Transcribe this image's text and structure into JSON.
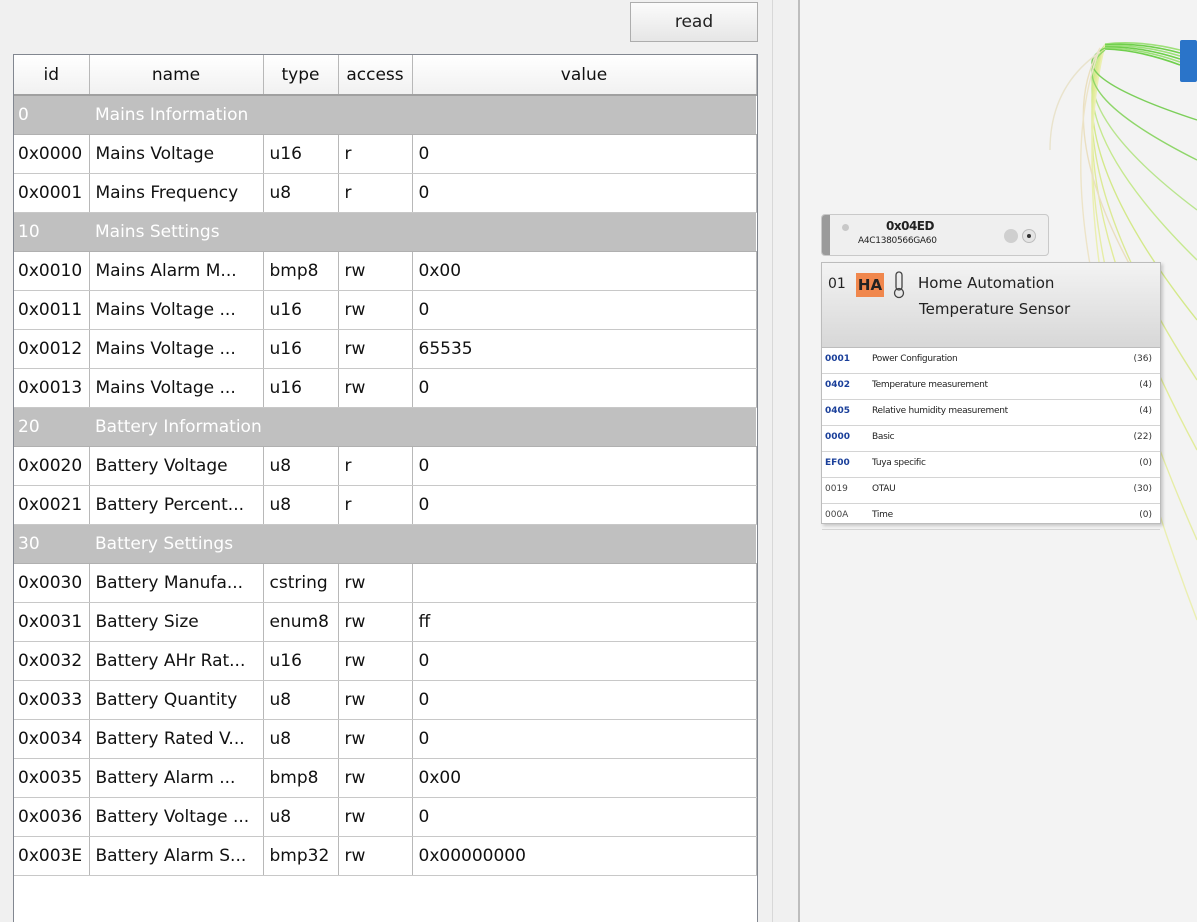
{
  "toolbar": {
    "read_label": "read"
  },
  "table": {
    "columns": [
      "id",
      "name",
      "type",
      "access",
      "value"
    ],
    "rows": [
      {
        "kind": "group",
        "id": "0",
        "name": "Mains Information"
      },
      {
        "kind": "attr",
        "id": "0x0000",
        "name": "Mains Voltage",
        "type": "u16",
        "access": "r",
        "value": "0"
      },
      {
        "kind": "attr",
        "id": "0x0001",
        "name": "Mains Frequency",
        "type": "u8",
        "access": "r",
        "value": "0"
      },
      {
        "kind": "group",
        "id": "10",
        "name": "Mains Settings"
      },
      {
        "kind": "attr",
        "id": "0x0010",
        "name": "Mains Alarm M...",
        "type": "bmp8",
        "access": "rw",
        "value": "0x00"
      },
      {
        "kind": "attr",
        "id": "0x0011",
        "name": "Mains Voltage ...",
        "type": "u16",
        "access": "rw",
        "value": "0"
      },
      {
        "kind": "attr",
        "id": "0x0012",
        "name": "Mains Voltage ...",
        "type": "u16",
        "access": "rw",
        "value": "65535"
      },
      {
        "kind": "attr",
        "id": "0x0013",
        "name": "Mains Voltage ...",
        "type": "u16",
        "access": "rw",
        "value": "0"
      },
      {
        "kind": "group",
        "id": "20",
        "name": "Battery Information"
      },
      {
        "kind": "attr",
        "id": "0x0020",
        "name": "Battery Voltage",
        "type": "u8",
        "access": "r",
        "value": "0"
      },
      {
        "kind": "attr",
        "id": "0x0021",
        "name": "Battery Percent...",
        "type": "u8",
        "access": "r",
        "value": "0"
      },
      {
        "kind": "group",
        "id": "30",
        "name": "Battery Settings"
      },
      {
        "kind": "attr",
        "id": "0x0030",
        "name": "Battery Manufa...",
        "type": "cstring",
        "access": "rw",
        "value": ""
      },
      {
        "kind": "attr",
        "id": "0x0031",
        "name": "Battery Size",
        "type": "enum8",
        "access": "rw",
        "value": "ff"
      },
      {
        "kind": "attr",
        "id": "0x0032",
        "name": "Battery AHr Rat...",
        "type": "u16",
        "access": "rw",
        "value": "0"
      },
      {
        "kind": "attr",
        "id": "0x0033",
        "name": "Battery Quantity",
        "type": "u8",
        "access": "rw",
        "value": "0"
      },
      {
        "kind": "attr",
        "id": "0x0034",
        "name": "Battery Rated V...",
        "type": "u8",
        "access": "rw",
        "value": "0"
      },
      {
        "kind": "attr",
        "id": "0x0035",
        "name": "Battery Alarm ...",
        "type": "bmp8",
        "access": "rw",
        "value": "0x00"
      },
      {
        "kind": "attr",
        "id": "0x0036",
        "name": "Battery Voltage ...",
        "type": "u8",
        "access": "rw",
        "value": "0"
      },
      {
        "kind": "attr",
        "id": "0x003E",
        "name": "Battery Alarm S...",
        "type": "bmp32",
        "access": "rw",
        "value": "0x00000000"
      }
    ]
  },
  "node": {
    "nwk_address": "0x04ED",
    "mac_address": "A4C1380566GA60",
    "endpoint": {
      "number": "01",
      "profile_badge": "HA",
      "device_line1": "Home Automation",
      "device_line2": "Temperature Sensor",
      "clusters": [
        {
          "id": "0001",
          "name": "Power Configuration",
          "count": "(36)",
          "highlight": true
        },
        {
          "id": "0402",
          "name": "Temperature measurement",
          "count": "(4)",
          "highlight": true
        },
        {
          "id": "0405",
          "name": "Relative humidity measurement",
          "count": "(4)",
          "highlight": true
        },
        {
          "id": "0000",
          "name": "Basic",
          "count": "(22)",
          "highlight": true
        },
        {
          "id": "EF00",
          "name": "Tuya specific",
          "count": "(0)",
          "highlight": true
        },
        {
          "id": "0019",
          "name": "OTAU",
          "count": "(30)",
          "highlight": false
        },
        {
          "id": "000A",
          "name": "Time",
          "count": "(0)",
          "highlight": false
        }
      ]
    }
  },
  "colors": {
    "group_row_bg": "#c0c0c0",
    "ha_badge": "#f0874d",
    "cluster_id_blue": "#1a3f9a",
    "link_green": "#7ccf5a",
    "link_yellow": "#d8e27a",
    "coordinator_blue": "#2a74c9"
  },
  "icons": {
    "endpoint_device": "thermometer-icon"
  }
}
